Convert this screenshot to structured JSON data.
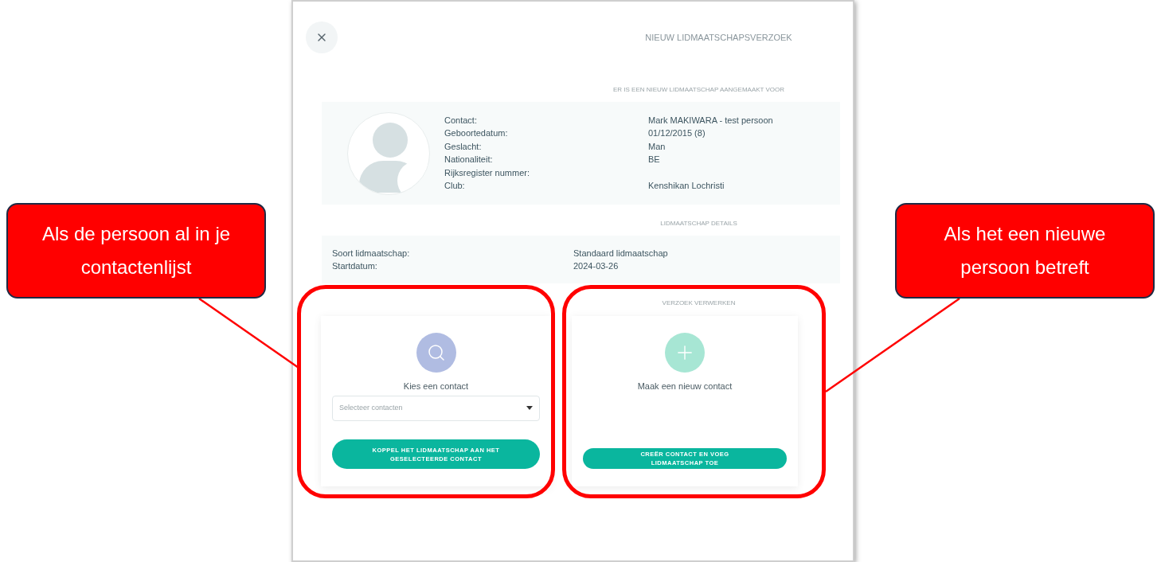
{
  "dialog": {
    "title": "NIEUW LIDMAATSCHAPSVERZOEK",
    "contact_section": {
      "heading": "ER IS EEN NIEUW LIDMAATSCHAP AANGEMAAKT VOOR",
      "fields": [
        {
          "label": "Contact:",
          "value": "Mark MAKIWARA - test persoon"
        },
        {
          "label": "Geboortedatum:",
          "value": "01/12/2015 (8)"
        },
        {
          "label": "Geslacht:",
          "value": "Man"
        },
        {
          "label": "Nationaliteit:",
          "value": "BE"
        },
        {
          "label": "Rijksregister nummer:"
        },
        {
          "label": "Club:",
          "value": "Kenshikan Lochristi"
        }
      ]
    },
    "details_section": {
      "heading": "LIDMAATSCHAP DETAILS",
      "fields": [
        {
          "label": "Soort lidmaatschap:",
          "value": "Standaard lidmaatschap"
        },
        {
          "label": "Startdatum:",
          "value": "2024-03-26"
        }
      ]
    },
    "process_section": {
      "heading": "VERZOEK VERWERKEN",
      "cards": [
        {
          "kind": "select",
          "title": "Kies een contact",
          "placeholder": "Selecteer contacten",
          "button": "KOPPEL HET LIDMAATSCHAP AAN HET GESELECTEERDE CONTACT"
        },
        {
          "kind": "create",
          "title": "Maak een nieuw contact",
          "button": "CREËR CONTACT EN VOEG LIDMAATSCHAP TOE"
        }
      ]
    }
  },
  "annotations": [
    {
      "text": "Als de persoon al in je contactenlijst"
    },
    {
      "text": "Als het een nieuwe persoon betreft"
    }
  ]
}
